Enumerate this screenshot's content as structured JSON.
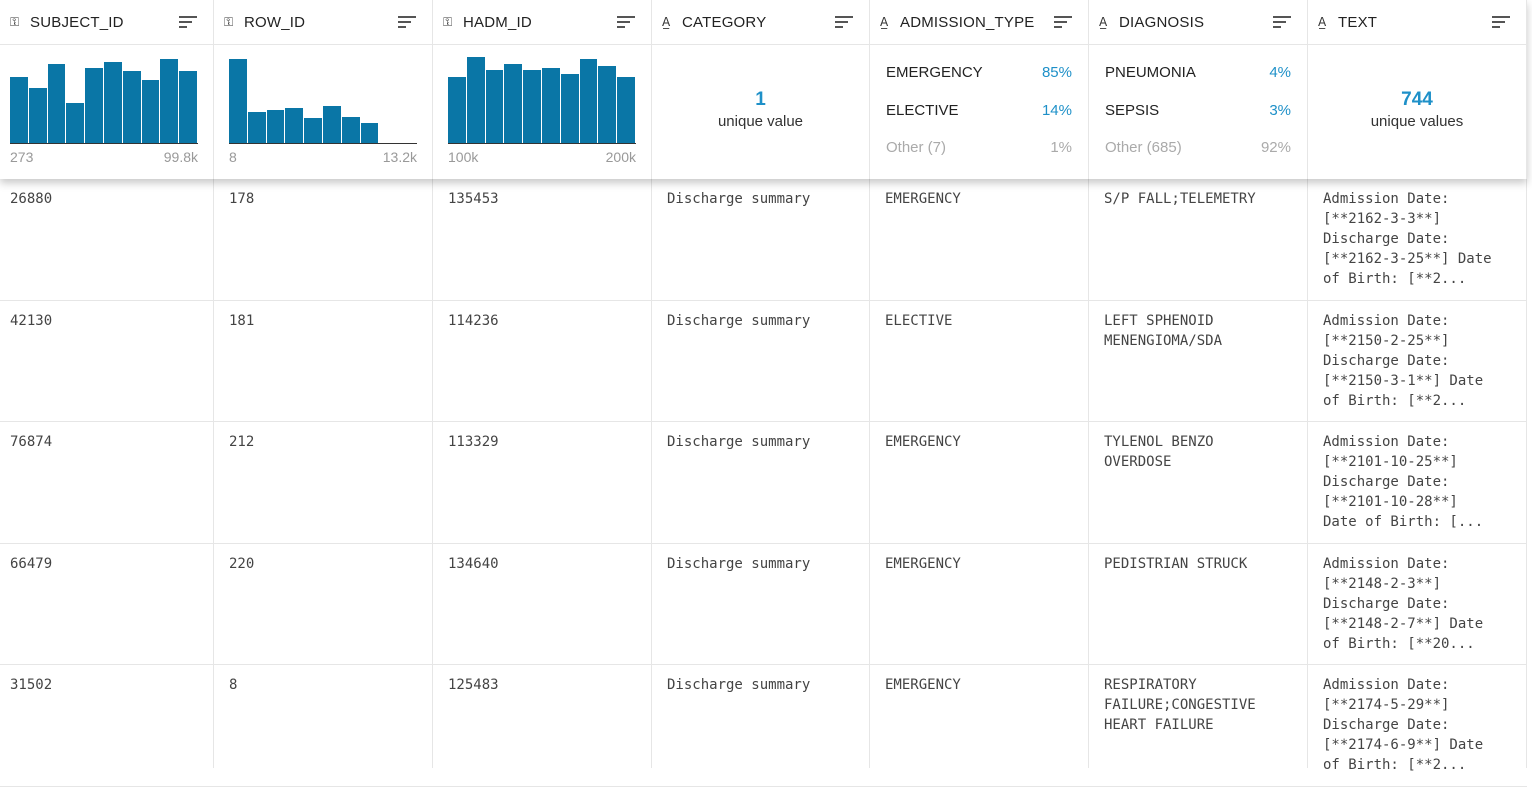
{
  "columns": [
    {
      "name": "SUBJECT_ID",
      "type_icon": "key-icon"
    },
    {
      "name": "ROW_ID",
      "type_icon": "key-icon"
    },
    {
      "name": "HADM_ID",
      "type_icon": "key-icon"
    },
    {
      "name": "CATEGORY",
      "type_icon": "text-type-icon"
    },
    {
      "name": "ADMISSION_TYPE",
      "type_icon": "text-type-icon"
    },
    {
      "name": "DIAGNOSIS",
      "type_icon": "text-type-icon"
    },
    {
      "name": "TEXT",
      "type_icon": "text-type-icon"
    }
  ],
  "summaries": {
    "subject_id": {
      "min": "273",
      "max": "99.8k",
      "bins": [
        0.75,
        0.62,
        0.9,
        0.45,
        0.85,
        0.92,
        0.82,
        0.72,
        0.95,
        0.82
      ]
    },
    "row_id": {
      "min": "8",
      "max": "13.2k",
      "bins": [
        0.95,
        0.35,
        0.38,
        0.4,
        0.28,
        0.42,
        0.3,
        0.23,
        0,
        0
      ]
    },
    "hadm_id": {
      "min": "100k",
      "max": "200k",
      "bins": [
        0.75,
        0.98,
        0.83,
        0.9,
        0.83,
        0.85,
        0.78,
        0.95,
        0.87,
        0.75
      ]
    },
    "category": {
      "count": "1",
      "label": "unique value"
    },
    "admission_type": {
      "items": [
        {
          "k": "EMERGENCY",
          "v": "85%"
        },
        {
          "k": "ELECTIVE",
          "v": "14%"
        }
      ],
      "other": {
        "k": "Other (7)",
        "v": "1%"
      }
    },
    "diagnosis": {
      "items": [
        {
          "k": "PNEUMONIA",
          "v": "4%"
        },
        {
          "k": "SEPSIS",
          "v": "3%"
        }
      ],
      "other": {
        "k": "Other (685)",
        "v": "92%"
      }
    },
    "text": {
      "count": "744",
      "label": "unique values"
    }
  },
  "rows": [
    {
      "subject_id": "26880",
      "row_id": "178",
      "hadm_id": "135453",
      "category": "Discharge summary",
      "admission_type": "EMERGENCY",
      "diagnosis": "S/P FALL;TELEMETRY",
      "text": "Admission Date:\n[**2162-3-3**]\nDischarge Date:\n[**2162-3-25**] Date\nof Birth: [**2..."
    },
    {
      "subject_id": "42130",
      "row_id": "181",
      "hadm_id": "114236",
      "category": "Discharge summary",
      "admission_type": "ELECTIVE",
      "diagnosis": "LEFT SPHENOID\nMENENGIOMA/SDA",
      "text": "Admission Date:\n[**2150-2-25**]\nDischarge Date:\n[**2150-3-1**] Date\nof Birth: [**2..."
    },
    {
      "subject_id": "76874",
      "row_id": "212",
      "hadm_id": "113329",
      "category": "Discharge summary",
      "admission_type": "EMERGENCY",
      "diagnosis": "TYLENOL BENZO\nOVERDOSE",
      "text": "Admission Date:\n[**2101-10-25**]\nDischarge Date:\n[**2101-10-28**]\nDate of Birth: [..."
    },
    {
      "subject_id": "66479",
      "row_id": "220",
      "hadm_id": "134640",
      "category": "Discharge summary",
      "admission_type": "EMERGENCY",
      "diagnosis": "PEDISTRIAN STRUCK",
      "text": "Admission Date:\n[**2148-2-3**]\nDischarge Date:\n[**2148-2-7**] Date\nof Birth: [**20..."
    },
    {
      "subject_id": "31502",
      "row_id": "8",
      "hadm_id": "125483",
      "category": "Discharge summary",
      "admission_type": "EMERGENCY",
      "diagnosis": "RESPIRATORY\nFAILURE;CONGESTIVE\nHEART FAILURE",
      "text": "Admission Date:\n[**2174-5-29**]\nDischarge Date:\n[**2174-6-9**] Date\nof Birth: [**2..."
    }
  ]
}
